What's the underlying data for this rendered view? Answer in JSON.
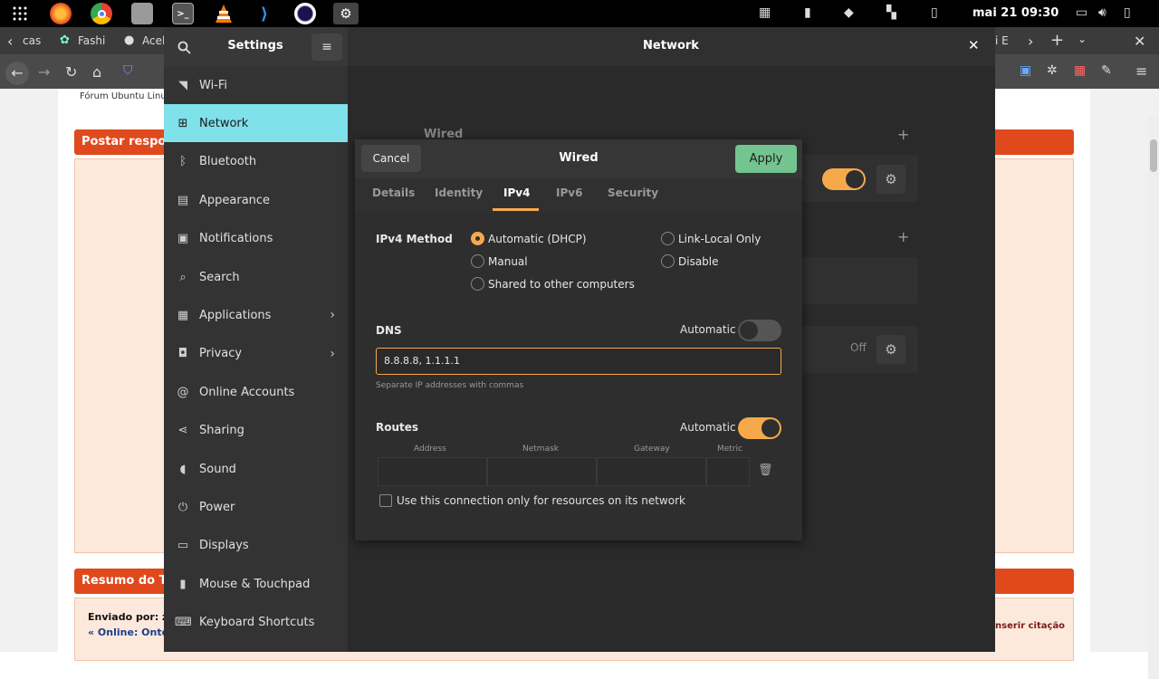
{
  "topbar": {
    "clock": "mai 21  09:30",
    "apps": [
      "apps-grid-icon",
      "firefox-icon",
      "chrome-icon",
      "files-icon",
      "terminal-icon",
      "vlc-icon",
      "vscode-icon",
      "eclipse-icon",
      "settings-icon"
    ]
  },
  "browser": {
    "tabs": [
      "cas",
      "Fashi",
      "Acel",
      "i E"
    ],
    "page": {
      "forum_link": "Fórum Ubuntu Linux",
      "post_reply_title": "Postar respos",
      "summary_title": "Resumo do To",
      "sent_by": "Enviado por: ze",
      "online": "« Online: Onte",
      "insert_quote": "nserir citação"
    }
  },
  "settings": {
    "title": "Settings",
    "panel_title": "Network",
    "sidebar": [
      {
        "label": "Wi-Fi",
        "icon": "wifi-icon",
        "active": false
      },
      {
        "label": "Network",
        "icon": "network-icon",
        "active": true
      },
      {
        "label": "Bluetooth",
        "icon": "bluetooth-icon",
        "active": false
      },
      {
        "label": "Appearance",
        "icon": "appearance-icon",
        "active": false
      },
      {
        "label": "Notifications",
        "icon": "bell-icon",
        "active": false
      },
      {
        "label": "Search",
        "icon": "search-icon",
        "active": false
      },
      {
        "label": "Applications",
        "icon": "applications-icon",
        "active": false,
        "arrow": true
      },
      {
        "label": "Privacy",
        "icon": "privacy-icon",
        "active": false,
        "arrow": true
      },
      {
        "label": "Online Accounts",
        "icon": "at-icon",
        "active": false
      },
      {
        "label": "Sharing",
        "icon": "share-icon",
        "active": false
      },
      {
        "label": "Sound",
        "icon": "speaker-icon",
        "active": false
      },
      {
        "label": "Power",
        "icon": "power-icon",
        "active": false
      },
      {
        "label": "Displays",
        "icon": "display-icon",
        "active": false
      },
      {
        "label": "Mouse & Touchpad",
        "icon": "mouse-icon",
        "active": false
      },
      {
        "label": "Keyboard Shortcuts",
        "icon": "keyboard-icon",
        "active": false
      }
    ],
    "network": {
      "wired_label": "Wired",
      "proxy_state": "Off"
    }
  },
  "dialog": {
    "title": "Wired",
    "cancel": "Cancel",
    "apply": "Apply",
    "tabs": [
      "Details",
      "Identity",
      "IPv4",
      "IPv6",
      "Security"
    ],
    "active_tab": "IPv4",
    "ipv4_method_label": "IPv4 Method",
    "methods": {
      "dhcp": "Automatic (DHCP)",
      "manual": "Manual",
      "shared": "Shared to other computers",
      "link_local": "Link-Local Only",
      "disable": "Disable"
    },
    "selected_method": "Automatic (DHCP)",
    "dns_label": "DNS",
    "automatic_label": "Automatic",
    "dns_automatic": false,
    "dns_value": "8.8.8.8, 1.1.1.1",
    "dns_hint": "Separate IP addresses with commas",
    "routes_label": "Routes",
    "routes_automatic": true,
    "route_columns": [
      "Address",
      "Netmask",
      "Gateway",
      "Metric"
    ],
    "only_resources_label": "Use this connection only for resources on its network",
    "only_resources_checked": false
  },
  "colors": {
    "accent_orange": "#f6a94b",
    "active_cyan": "#7fe1ea",
    "apply_green": "#73c48f",
    "forum_orange": "#e0491c"
  }
}
